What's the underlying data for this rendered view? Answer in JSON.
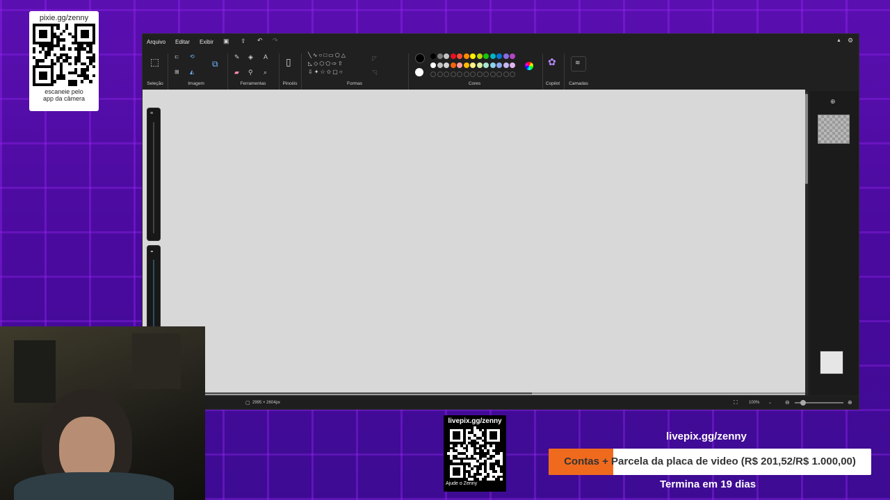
{
  "qr_top": {
    "url": "pixie.gg/zenny",
    "caption_line1": "escaneie pelo",
    "caption_line2": "app da câmera"
  },
  "qr_bottom": {
    "url": "livepix.gg/zenny",
    "caption": "Ajude o Zenny"
  },
  "paint": {
    "menu": [
      "Arquivo",
      "Editar",
      "Exibir"
    ],
    "groups": {
      "selection": "Seleção",
      "image": "Imagem",
      "tools": "Ferramentas",
      "brushes": "Pincéis",
      "shapes": "Formas",
      "colors": "Cores",
      "copilot": "Copilot",
      "layers": "Camadas"
    },
    "palette_row1": [
      "#000000",
      "#7f7f7f",
      "#c3c3c3",
      "#e81123",
      "#ff4b33",
      "#ff8c00",
      "#fff100",
      "#bad80a",
      "#16c60c",
      "#00b7c3",
      "#0078d4",
      "#886ce4",
      "#b146c2"
    ],
    "palette_row2": [
      "#ffffff",
      "#c3c3c3",
      "#d4d4d4",
      "#f7630c",
      "#ff9e9e",
      "#ffb900",
      "#fff685",
      "#d8f0a0",
      "#a8e6cf",
      "#8fd1f0",
      "#8fa9f0",
      "#c8b6f0",
      "#e0b6f0"
    ],
    "status": {
      "dimensions": "2995 × 2604px",
      "zoom": "100%"
    }
  },
  "goal": {
    "url": "livepix.gg/zenny",
    "text": "Contas + Parcela da placa de video (R$ 201,52/R$ 1.000,00)",
    "progress": 0.2015,
    "ends": "Termina em 19 dias",
    "fill_color": "#f06a1e"
  }
}
